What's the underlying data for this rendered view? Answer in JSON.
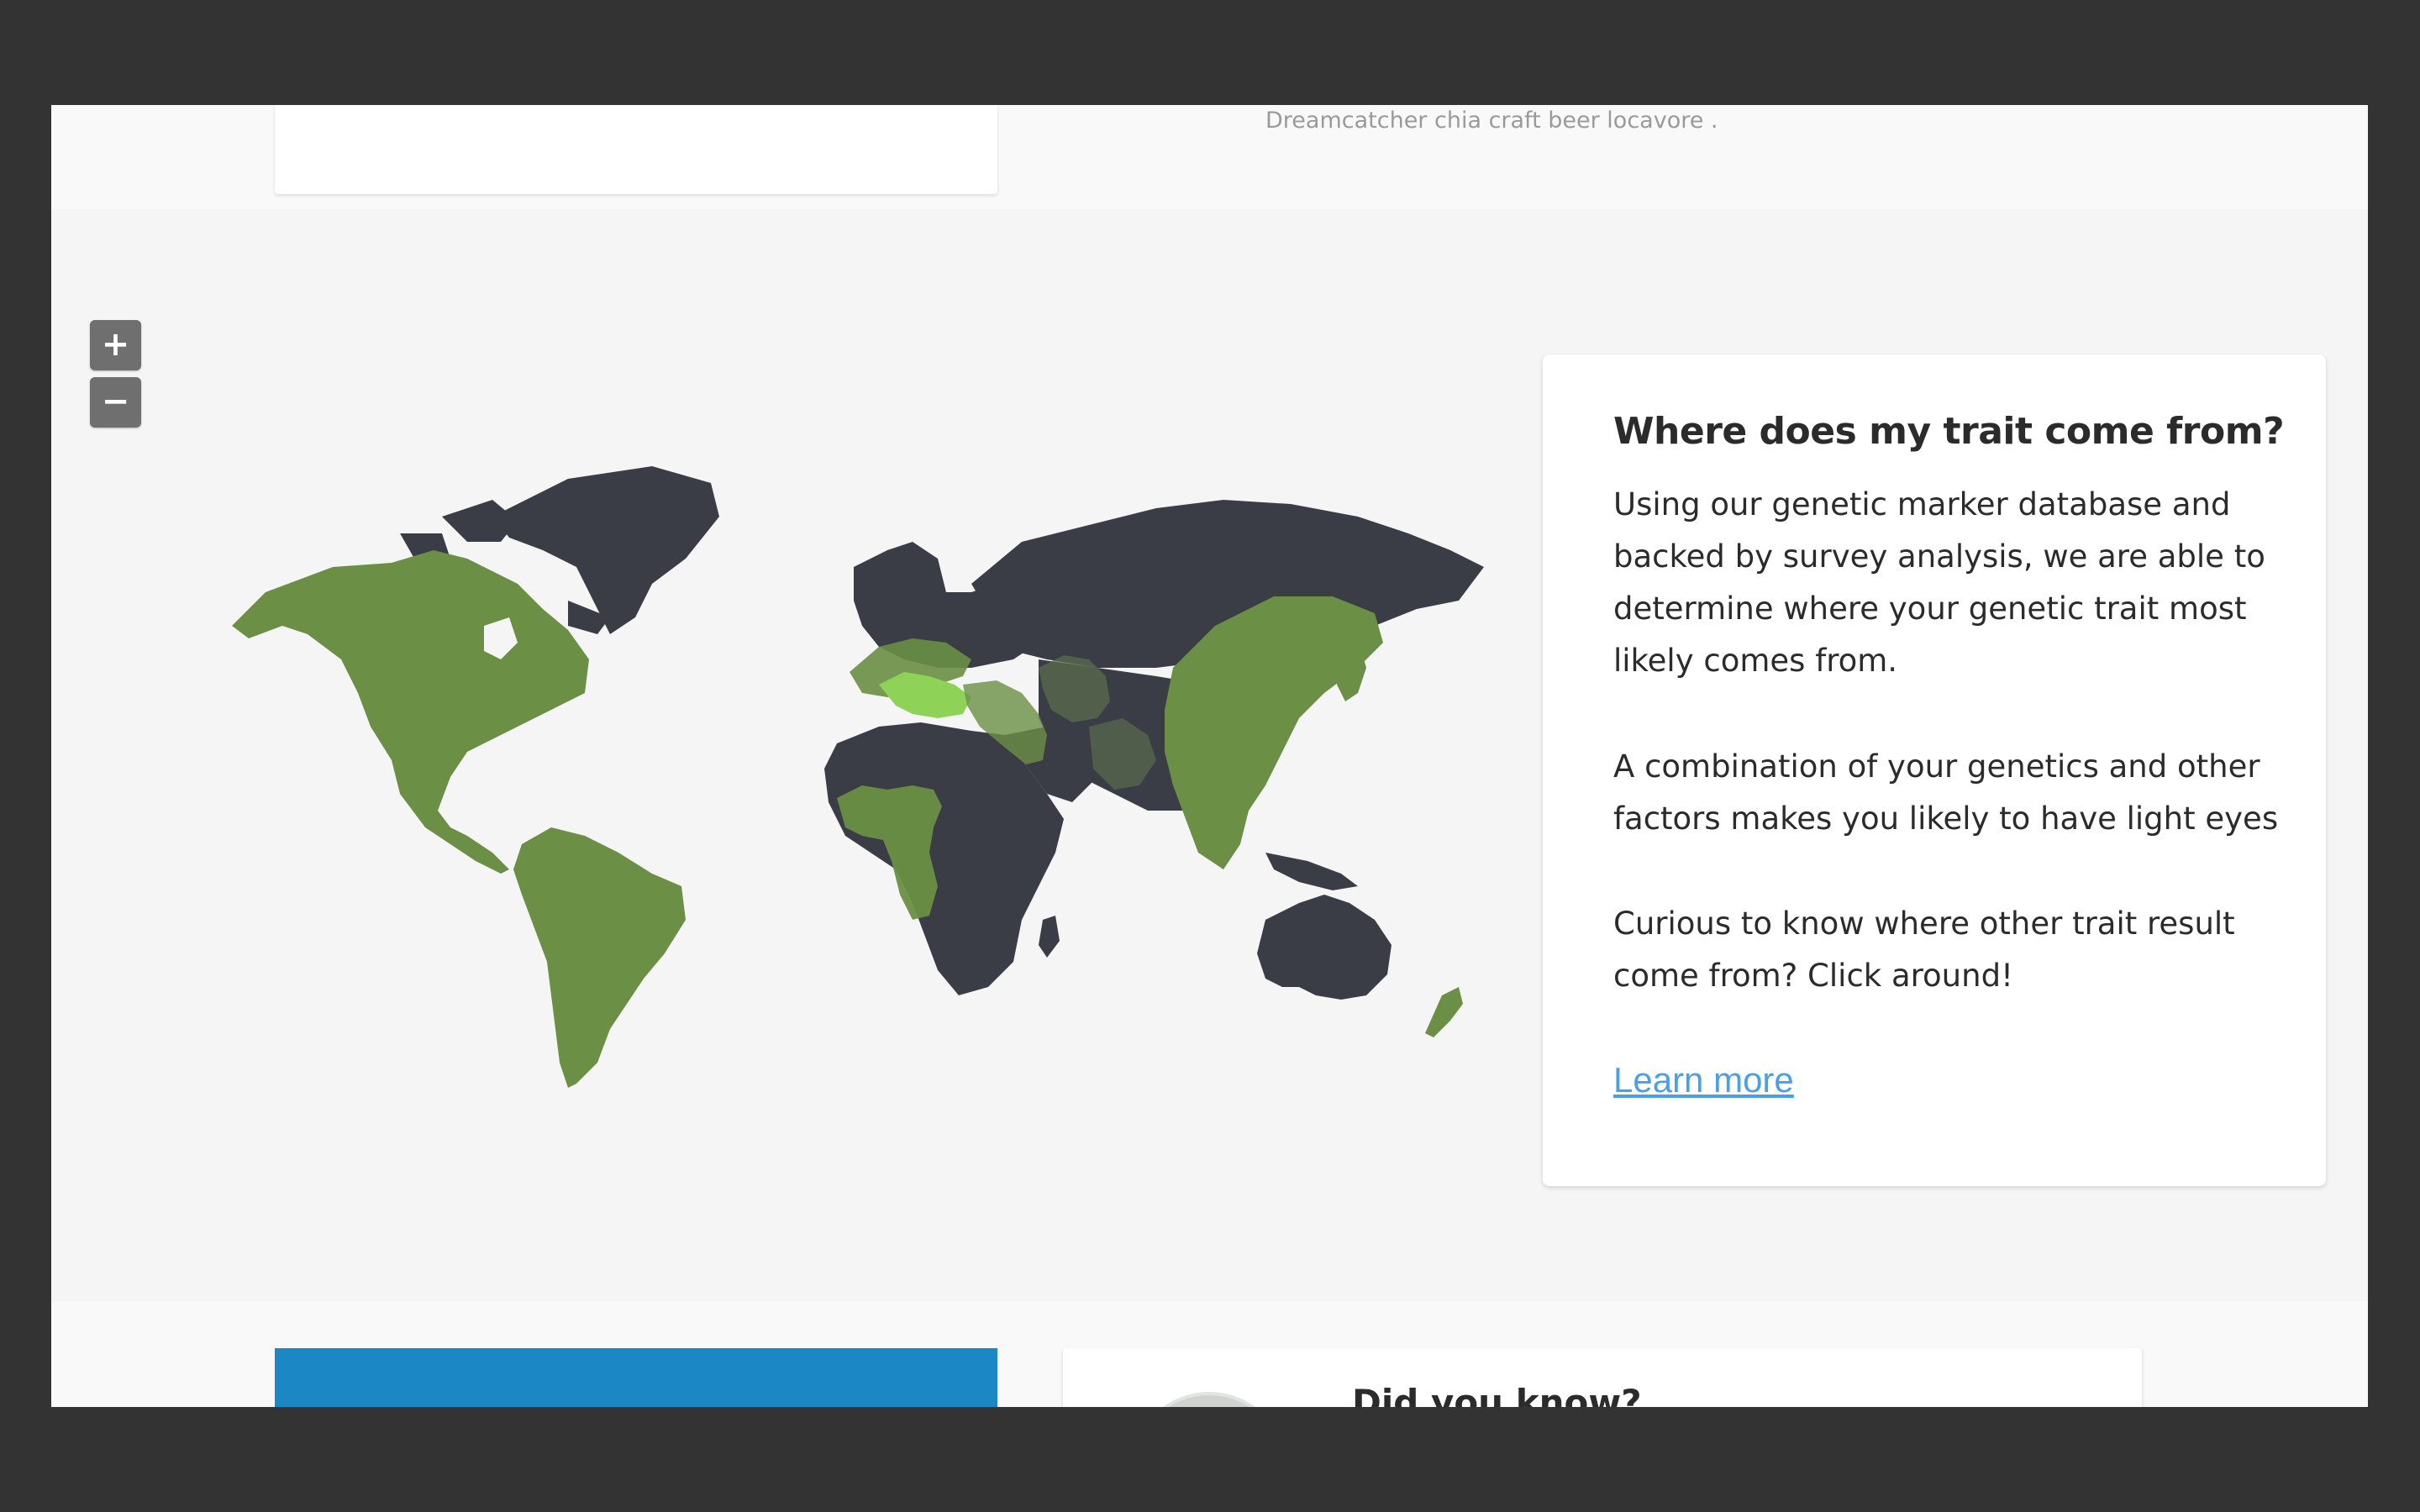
{
  "top": {
    "caption": "Dreamcatcher chia craft beer locavore ."
  },
  "map": {
    "zoom_in_label": "+",
    "zoom_out_label": "−",
    "colors": {
      "land": "#3a3d45",
      "region": "#6a8f45",
      "region_highlight": "#8ed257",
      "background": "#f5f5f5"
    }
  },
  "info": {
    "title": "Where does my trait come from?",
    "p1": "Using our genetic marker database and backed by survey analysis, we are able to determine where your genetic trait most likely comes from.",
    "p2": "A combination of your genetics and other factors makes you likely to have light eyes",
    "p3": "Curious to know where other trait result come from? Click around!",
    "learn_more": "Learn more"
  },
  "bottom": {
    "did_you_know": "Did you know?"
  }
}
